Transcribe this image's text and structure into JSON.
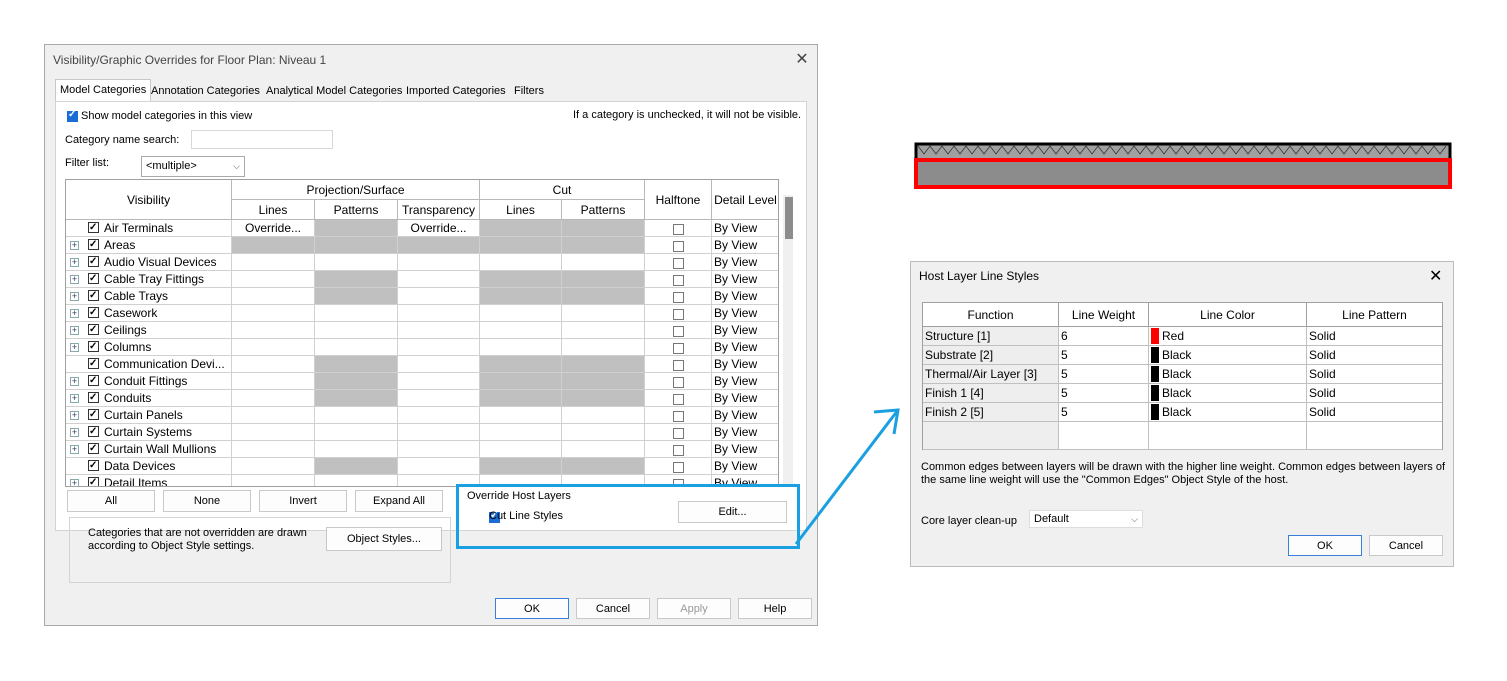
{
  "vg_dialog": {
    "title": "Visibility/Graphic Overrides for Floor Plan: Niveau 1",
    "close": "✕",
    "tabs": [
      "Model Categories",
      "Annotation Categories",
      "Analytical Model Categories",
      "Imported Categories",
      "Filters"
    ],
    "show_model_label": "Show model categories in this view",
    "hint": "If a category is unchecked, it will not be visible.",
    "search_label": "Category name search:",
    "filter_label": "Filter list:",
    "filter_value": "<multiple>",
    "headers": {
      "visibility": "Visibility",
      "projection": "Projection/Surface",
      "cut": "Cut",
      "lines": "Lines",
      "patterns": "Patterns",
      "transparency": "Transparency",
      "halftone": "Halftone",
      "detail_level": "Detail Level"
    },
    "rows": [
      {
        "name": "Air Terminals",
        "expand": false,
        "lines": "Override...",
        "transparency": "Override...",
        "detail": "By View"
      },
      {
        "name": "Areas",
        "expand": true,
        "lines": "",
        "transparency": "",
        "detail": "By View"
      },
      {
        "name": "Audio Visual Devices",
        "expand": true,
        "lines": "",
        "transparency": "",
        "detail": "By View"
      },
      {
        "name": "Cable Tray Fittings",
        "expand": true,
        "lines": "",
        "transparency": "",
        "detail": "By View"
      },
      {
        "name": "Cable Trays",
        "expand": true,
        "lines": "",
        "transparency": "",
        "detail": "By View"
      },
      {
        "name": "Casework",
        "expand": true,
        "lines": "",
        "transparency": "",
        "detail": "By View"
      },
      {
        "name": "Ceilings",
        "expand": true,
        "lines": "",
        "transparency": "",
        "detail": "By View"
      },
      {
        "name": "Columns",
        "expand": true,
        "lines": "",
        "transparency": "",
        "detail": "By View"
      },
      {
        "name": "Communication Devi...",
        "expand": false,
        "lines": "",
        "transparency": "",
        "detail": "By View"
      },
      {
        "name": "Conduit Fittings",
        "expand": true,
        "lines": "",
        "transparency": "",
        "detail": "By View"
      },
      {
        "name": "Conduits",
        "expand": true,
        "lines": "",
        "transparency": "",
        "detail": "By View"
      },
      {
        "name": "Curtain Panels",
        "expand": true,
        "lines": "",
        "transparency": "",
        "detail": "By View"
      },
      {
        "name": "Curtain Systems",
        "expand": true,
        "lines": "",
        "transparency": "",
        "detail": "By View"
      },
      {
        "name": "Curtain Wall Mullions",
        "expand": true,
        "lines": "",
        "transparency": "",
        "detail": "By View"
      },
      {
        "name": "Data Devices",
        "expand": false,
        "lines": "",
        "transparency": "",
        "detail": "By View"
      },
      {
        "name": "Detail Items",
        "expand": true,
        "lines": "",
        "transparency": "",
        "detail": "By View"
      }
    ],
    "buttons": {
      "all": "All",
      "none": "None",
      "invert": "Invert",
      "expand_all": "Expand All"
    },
    "object_styles_note": "Categories that are not overridden are drawn according to Object Style settings.",
    "object_styles_button": "Object Styles...",
    "override_host_title": "Override Host Layers",
    "cut_line_styles_label": "Cut Line Styles",
    "edit_button": "Edit...",
    "ok": "OK",
    "cancel": "Cancel",
    "apply": "Apply",
    "help": "Help"
  },
  "host_dialog": {
    "title": "Host Layer Line Styles",
    "close": "✕",
    "headers": [
      "Function",
      "Line Weight",
      "Line Color",
      "Line Pattern"
    ],
    "rows": [
      {
        "function": "Structure [1]",
        "weight": "6",
        "color": "Red",
        "color_hex": "#ff0000",
        "pattern": "Solid"
      },
      {
        "function": "Substrate [2]",
        "weight": "5",
        "color": "Black",
        "color_hex": "#000000",
        "pattern": "Solid"
      },
      {
        "function": "Thermal/Air Layer [3]",
        "weight": "5",
        "color": "Black",
        "color_hex": "#000000",
        "pattern": "Solid"
      },
      {
        "function": "Finish 1 [4]",
        "weight": "5",
        "color": "Black",
        "color_hex": "#000000",
        "pattern": "Solid"
      },
      {
        "function": "Finish 2 [5]",
        "weight": "5",
        "color": "Black",
        "color_hex": "#000000",
        "pattern": "Solid"
      }
    ],
    "note": "Common edges between layers will be drawn with the higher line weight.  Common edges between layers of the same line weight will use the \"Common Edges\" Object Style of the host.",
    "core_label": "Core layer clean-up",
    "core_value": "Default",
    "ok": "OK",
    "cancel": "Cancel"
  },
  "colors": {
    "highlight": "#1aa0e0",
    "override_gray": "#c0c0c0",
    "structure_red": "#ff0000"
  }
}
